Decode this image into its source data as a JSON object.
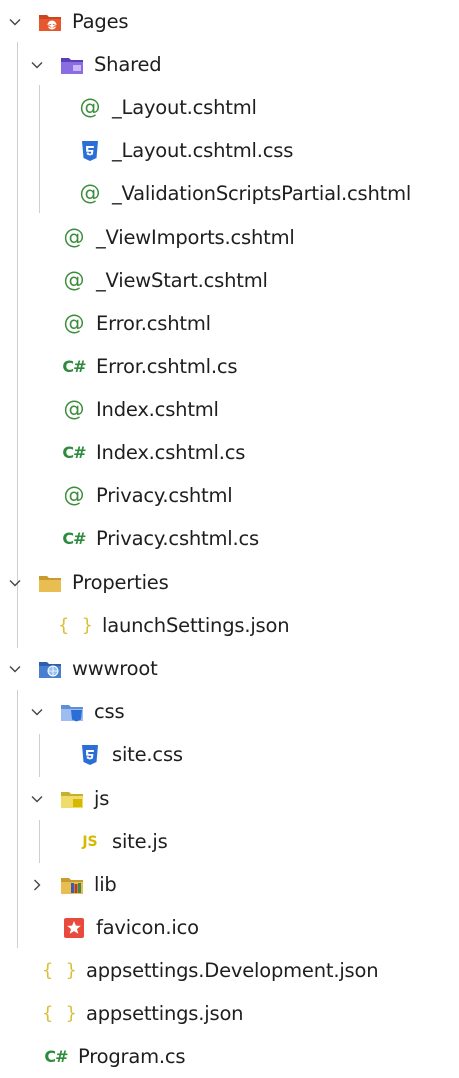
{
  "tree": {
    "pages": {
      "label": "Pages",
      "icon": "razor-pages-folder-icon",
      "shared": {
        "label": "Shared",
        "icon": "shared-folder-icon",
        "items": [
          "_Layout.cshtml",
          "_Layout.cshtml.css",
          "_ValidationScriptsPartial.cshtml"
        ]
      },
      "items": [
        "_ViewImports.cshtml",
        "_ViewStart.cshtml",
        "Error.cshtml",
        "Error.cshtml.cs",
        "Index.cshtml",
        "Index.cshtml.cs",
        "Privacy.cshtml",
        "Privacy.cshtml.cs"
      ]
    },
    "properties": {
      "label": "Properties",
      "icon": "folder-icon",
      "items": [
        "launchSettings.json"
      ]
    },
    "wwwroot": {
      "label": "wwwroot",
      "icon": "web-folder-icon",
      "css": {
        "label": "css",
        "icon": "css-folder-icon",
        "items": [
          "site.css"
        ]
      },
      "js": {
        "label": "js",
        "icon": "js-folder-icon",
        "items": [
          "site.js"
        ]
      },
      "lib": {
        "label": "lib",
        "icon": "library-folder-icon"
      },
      "items": [
        "favicon.ico"
      ]
    },
    "root_items": [
      "appsettings.Development.json",
      "appsettings.json",
      "Program.cs"
    ]
  },
  "colors": {
    "razor": "#3b8c3b",
    "csharp": "#2e8b3d",
    "css": "#2a6fd6",
    "json": "#d8c13a",
    "folder": "#e3b13d",
    "pages_folder": "#e2552f",
    "shared_folder": "#7d5fd6",
    "favicon": "#e84a3d"
  }
}
